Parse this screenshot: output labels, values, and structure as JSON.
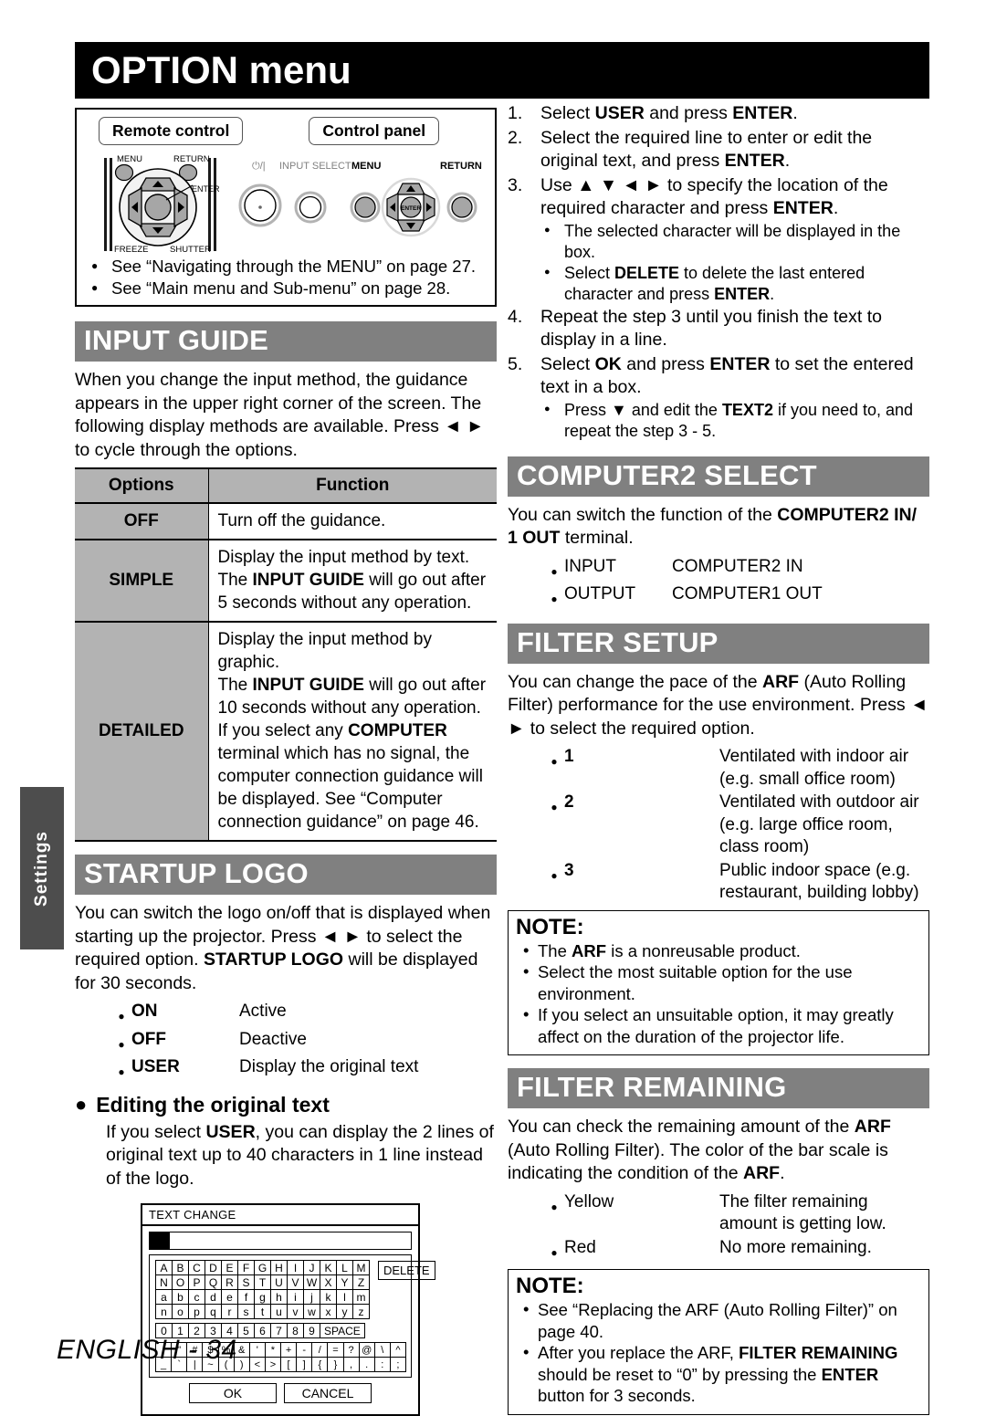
{
  "page": {
    "title": "OPTION menu",
    "side_tab": "Settings",
    "footer": "ENGLISH - 34"
  },
  "colors": {
    "title_bar_bg": "#000000",
    "section_bar_bg": "#808080",
    "section_bar_text": "#ffffff",
    "table_header_bg": "#b3b3b3",
    "side_tab_bg": "#4d4d4d"
  },
  "control_diagram": {
    "remote_label": "Remote control",
    "panel_label": "Control panel",
    "remote_keys": {
      "menu": "MENU",
      "return": "RETURN",
      "enter": "ENTER",
      "freeze": "FREEZE",
      "shutter": "SHUTTER"
    },
    "panel_keys": {
      "power": "⏻/|",
      "input_select": "INPUT SELECT",
      "menu": "MENU",
      "enter": "ENTER",
      "return": "RETURN"
    },
    "references": [
      "See “Navigating through the MENU” on page 27.",
      "See “Main menu and Sub-menu” on page 28."
    ]
  },
  "input_guide": {
    "heading": "INPUT GUIDE",
    "intro_1": "When you change the input method, the guidance appears in the upper right corner of the screen. The following display methods are available. Press ",
    "intro_2": " to cycle through the options.",
    "table": {
      "headers": [
        "Options",
        "Function"
      ],
      "rows": [
        {
          "option": "OFF",
          "function_lines": [
            "Turn off the guidance."
          ]
        },
        {
          "option": "SIMPLE",
          "function_lines": [
            "Display the input method by text.",
            "The INPUT GUIDE will go out after",
            "5 seconds without any operation."
          ]
        },
        {
          "option": "DETAILED",
          "function_lines": [
            "Display the input method by graphic.",
            "The INPUT GUIDE will go out after",
            "10 seconds without any operation.",
            "If you select any COMPUTER",
            "terminal which has no signal, the",
            "computer connection guidance will",
            "be displayed. See “Computer",
            "connection guidance” on page 46."
          ]
        }
      ]
    }
  },
  "startup_logo": {
    "heading": "STARTUP LOGO",
    "intro_1": "You can switch the logo on/off that is displayed when starting up the projector. Press ",
    "intro_2": " to select the required option. ",
    "intro_bold": "STARTUP LOGO",
    "intro_3": " will be displayed for 30 seconds.",
    "options": [
      {
        "term": "ON",
        "desc": "Active"
      },
      {
        "term": "OFF",
        "desc": "Deactive"
      },
      {
        "term": "USER",
        "desc": "Display the original text"
      }
    ],
    "subhead": "Editing the original text",
    "sub_text_1": "If you select ",
    "sub_text_bold": "USER",
    "sub_text_2": ", you can display the 2 lines of original text up to 40 characters in 1 line instead of the logo."
  },
  "text_change_osd": {
    "title": "TEXT CHANGE",
    "delete_label": "DELETE",
    "space_label": "SPACE",
    "ok_label": "OK",
    "cancel_label": "CANCEL",
    "rows_upper": [
      [
        "A",
        "B",
        "C",
        "D",
        "E",
        "F",
        "G",
        "H",
        "I",
        "J",
        "K",
        "L",
        "M"
      ],
      [
        "N",
        "O",
        "P",
        "Q",
        "R",
        "S",
        "T",
        "U",
        "V",
        "W",
        "X",
        "Y",
        "Z"
      ]
    ],
    "rows_lower": [
      [
        "a",
        "b",
        "c",
        "d",
        "e",
        "f",
        "g",
        "h",
        "i",
        "j",
        "k",
        "l",
        "m"
      ],
      [
        "n",
        "o",
        "p",
        "q",
        "r",
        "s",
        "t",
        "u",
        "v",
        "w",
        "x",
        "y",
        "z"
      ]
    ],
    "row_digits": [
      "0",
      "1",
      "2",
      "3",
      "4",
      "5",
      "6",
      "7",
      "8",
      "9"
    ],
    "rows_symbols": [
      [
        "!",
        "\"",
        "#",
        "$",
        "%",
        "&",
        "'",
        "*",
        "+",
        "-",
        "/",
        "=",
        "?",
        "@",
        "\\",
        "^"
      ],
      [
        "_",
        "`",
        "|",
        "~",
        "(",
        ")",
        "<",
        ">",
        "[",
        "]",
        "{",
        "}",
        ",",
        ".",
        ":",
        ";"
      ]
    ]
  },
  "steps": {
    "items": [
      {
        "num": "1.",
        "parts": [
          {
            "t": "Select ",
            "b": false
          },
          {
            "t": "USER",
            "b": true
          },
          {
            "t": " and press ",
            "b": false
          },
          {
            "t": "ENTER",
            "b": true
          },
          {
            "t": ".",
            "b": false
          }
        ],
        "sub": []
      },
      {
        "num": "2.",
        "parts": [
          {
            "t": "Select the required line to enter or edit the original text, and press ",
            "b": false
          },
          {
            "t": "ENTER",
            "b": true
          },
          {
            "t": ".",
            "b": false
          }
        ],
        "sub": []
      },
      {
        "num": "3.",
        "parts": [
          {
            "t": "Use ",
            "b": false
          },
          {
            "t": "▲ ▼ ◄ ►",
            "b": false
          },
          {
            "t": " to specify the location of the required character and press ",
            "b": false
          },
          {
            "t": "ENTER",
            "b": true
          },
          {
            "t": ".",
            "b": false
          }
        ],
        "sub": [
          [
            {
              "t": "The selected character will be displayed in the box.",
              "b": false
            }
          ],
          [
            {
              "t": "Select ",
              "b": false
            },
            {
              "t": "DELETE",
              "b": true
            },
            {
              "t": " to delete the last entered character and press ",
              "b": false
            },
            {
              "t": "ENTER",
              "b": true
            },
            {
              "t": ".",
              "b": false
            }
          ]
        ]
      },
      {
        "num": "4.",
        "parts": [
          {
            "t": "Repeat the step 3 until you finish the text to display in a line.",
            "b": false
          }
        ],
        "sub": []
      },
      {
        "num": "5.",
        "parts": [
          {
            "t": "Select ",
            "b": false
          },
          {
            "t": "OK",
            "b": true
          },
          {
            "t": " and press ",
            "b": false
          },
          {
            "t": "ENTER",
            "b": true
          },
          {
            "t": " to set the entered text in a box.",
            "b": false
          }
        ],
        "sub": [
          [
            {
              "t": "Press ",
              "b": false
            },
            {
              "t": "▼",
              "b": false
            },
            {
              "t": " and edit the ",
              "b": false
            },
            {
              "t": "TEXT2",
              "b": true
            },
            {
              "t": " if you need to, and repeat the step 3 - 5.",
              "b": false
            }
          ]
        ]
      }
    ]
  },
  "computer2_select": {
    "heading": "COMPUTER2 SELECT",
    "intro_1": "You can switch the function of the ",
    "intro_bold": "COMPUTER2 IN/ 1 OUT",
    "intro_2": " terminal.",
    "options": [
      {
        "term": "INPUT",
        "desc": "COMPUTER2 IN"
      },
      {
        "term": "OUTPUT",
        "desc": "COMPUTER1 OUT"
      }
    ]
  },
  "filter_setup": {
    "heading": "FILTER SETUP",
    "intro_1": "You can change the pace of the ",
    "intro_bold": "ARF",
    "intro_2": " (Auto Rolling Filter) performance for the use environment. Press ",
    "intro_3": " to select the required option.",
    "options": [
      {
        "term": "1",
        "desc": "Ventilated with indoor air (e.g. small office room)"
      },
      {
        "term": "2",
        "desc": "Ventilated with outdoor air (e.g. large office room, class room)"
      },
      {
        "term": "3",
        "desc": "Public indoor space (e.g. restaurant, building lobby)"
      }
    ],
    "note": {
      "heading": "NOTE:",
      "items": [
        [
          {
            "t": "The ",
            "b": false
          },
          {
            "t": "ARF",
            "b": true
          },
          {
            "t": " is a nonreusable product.",
            "b": false
          }
        ],
        [
          {
            "t": "Select the most suitable option for the use environment.",
            "b": false
          }
        ],
        [
          {
            "t": "If you select an unsuitable option, it may greatly affect on the duration of the projector life.",
            "b": false
          }
        ]
      ]
    }
  },
  "filter_remaining": {
    "heading": "FILTER REMAINING",
    "intro_1": "You can check the remaining amount of the ",
    "intro_bold": "ARF",
    "intro_2": " (Auto Rolling Filter). The color of the bar scale is indicating the condition of the ",
    "intro_bold2": "ARF",
    "intro_3": ".",
    "options": [
      {
        "term": "Yellow",
        "desc": "The filter remaining amount is getting low."
      },
      {
        "term": "Red",
        "desc": "No more remaining."
      }
    ],
    "note": {
      "heading": "NOTE:",
      "items": [
        [
          {
            "t": "See “Replacing the ARF (Auto Rolling Filter)” on page 40.",
            "b": false
          }
        ],
        [
          {
            "t": "After you replace the ARF, ",
            "b": false
          },
          {
            "t": "FILTER REMAINING",
            "b": true
          },
          {
            "t": " should be reset to “0” by pressing the ",
            "b": false
          },
          {
            "t": "ENTER",
            "b": true
          },
          {
            "t": " button for 3 seconds.",
            "b": false
          }
        ]
      ]
    }
  }
}
